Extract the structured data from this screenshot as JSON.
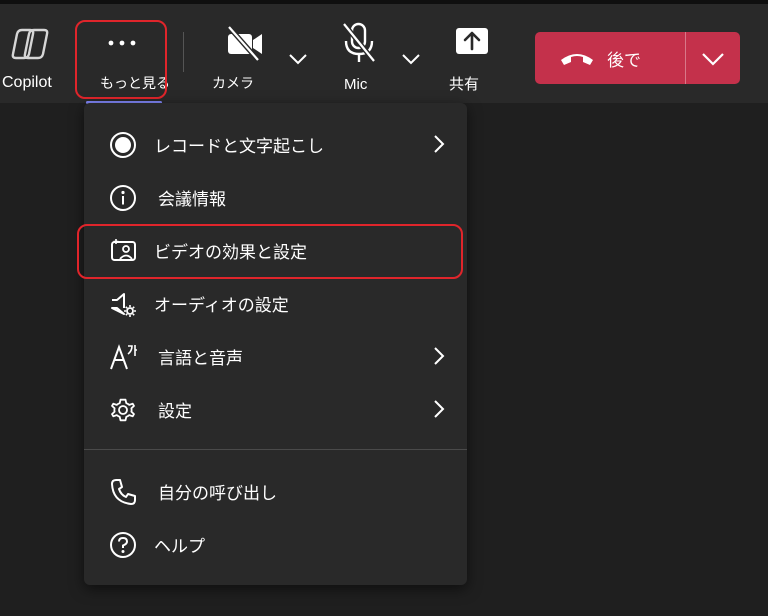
{
  "toolbar": {
    "copilot_label": "Copilot",
    "more_label": "もっと見る",
    "camera_label": "カメラ",
    "mic_label": "Mic",
    "share_label": "共有",
    "leave_label": "後で"
  },
  "icons": {
    "copilot": "copilot-icon",
    "more": "more-dots-icon",
    "camera": "camera-off-icon",
    "mic": "mic-off-icon",
    "share": "share-icon",
    "leave": "hang-up-icon",
    "chevron": "chevron-down-icon"
  },
  "menu": {
    "items": [
      {
        "label": "レコードと文字起こし",
        "icon": "record-icon",
        "has_submenu": true
      },
      {
        "label": "会議情報",
        "icon": "info-icon",
        "has_submenu": false
      },
      {
        "label": "ビデオの効果と設定",
        "icon": "video-effects-icon",
        "has_submenu": false
      },
      {
        "label": "オーディオの設定",
        "icon": "speaker-settings-icon",
        "has_submenu": false
      },
      {
        "label": "言語と音声",
        "icon": "language-icon",
        "has_submenu": true
      },
      {
        "label": "設定",
        "icon": "gear-icon",
        "has_submenu": true
      },
      {
        "label": "自分の呼び出し",
        "icon": "phone-icon",
        "has_submenu": false
      },
      {
        "label": "ヘルプ",
        "icon": "help-icon",
        "has_submenu": false
      }
    ]
  },
  "colors": {
    "background": "#1f1f1f",
    "toolbar": "#292929",
    "menu": "#292929",
    "leave_button": "#c4314b",
    "highlight": "#e0252b",
    "active_underline": "#7f85f5"
  }
}
